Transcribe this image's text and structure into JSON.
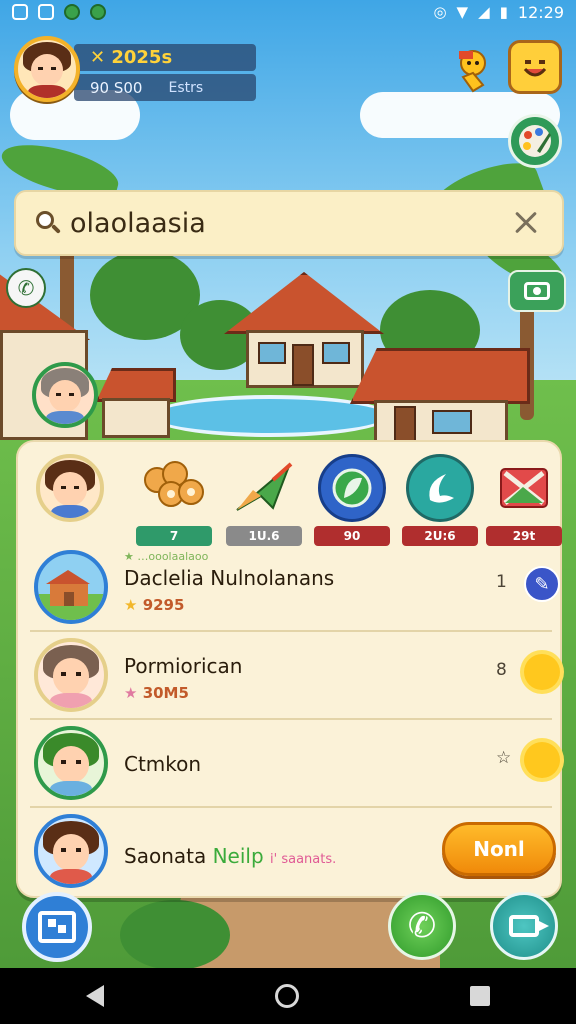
{
  "status_bar": {
    "time": "12:29"
  },
  "hud": {
    "coins": "✕ 2025s",
    "level": "90 S00",
    "sub": "Estrs"
  },
  "search": {
    "value": "olaolaasia"
  },
  "items": [
    {
      "icon": "cookies-icon",
      "badge": "7",
      "color": "#2f9a6a"
    },
    {
      "icon": "paper-plane-icon",
      "badge": "1U.6",
      "color": "#8a8a8a"
    },
    {
      "icon": "shield-leaf-icon",
      "badge": "90",
      "color": "#b02e2e"
    },
    {
      "icon": "boomerang-icon",
      "badge": "2U:6",
      "color": "#b02e2e"
    },
    {
      "icon": "envelope-x-icon",
      "badge": "29t",
      "color": "#b02e2e"
    }
  ],
  "friends": [
    {
      "tag": "★ …ooolaalaoo",
      "name": "Daclelia Nulnolanans",
      "score": "9295",
      "rank": "1"
    },
    {
      "name": "Pormiorican",
      "score": "30M5",
      "rank": "8"
    },
    {
      "name": "Ctmkon",
      "rank": "☆"
    },
    {
      "name": "Saonata",
      "sub_green": "Neilp",
      "sub_pink": "i' saanats.",
      "action_label": "Nonl"
    }
  ],
  "colors": {
    "accent": "#f3b22a",
    "panel": "#fbf2d8",
    "play": "#f08a0a"
  }
}
